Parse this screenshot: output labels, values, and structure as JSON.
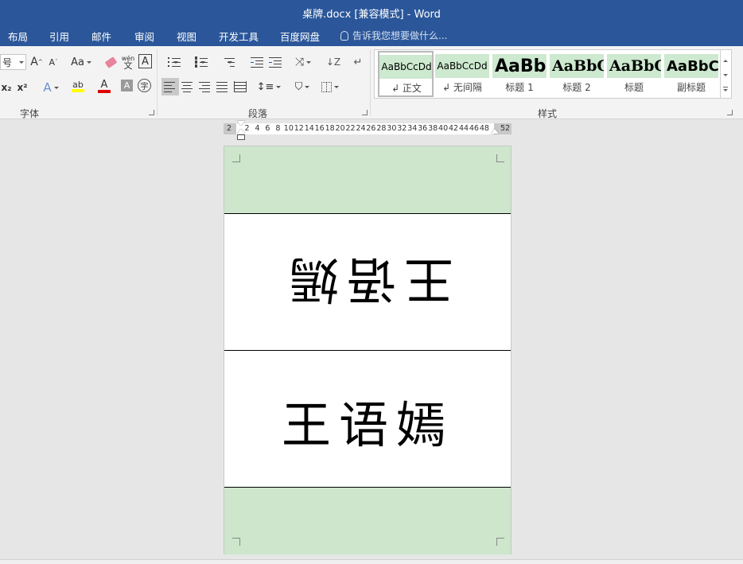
{
  "window": {
    "title": "桌牌.docx [兼容模式] - Word"
  },
  "tabs": [
    "布局",
    "引用",
    "邮件",
    "审阅",
    "视图",
    "开发工具",
    "百度网盘"
  ],
  "tell_me": "告诉我您想要做什么...",
  "font_group": {
    "label": "字体",
    "size_fragment": "号",
    "grow_label": "A",
    "shrink_label": "A",
    "case_label": "Aa",
    "phonetic_label": "wén",
    "phonetic_char": "文",
    "border_char": "A",
    "subscript": "x₂",
    "superscript": "x²",
    "text_effect_label": "A",
    "highlight_label": "ab",
    "font_color_label": "A",
    "char_shading_label": "A",
    "enclose_label": "字",
    "highlight_color": "#ffff00",
    "font_color": "#e00000"
  },
  "paragraph_group": {
    "label": "段落"
  },
  "styles_group": {
    "label": "样式",
    "styles": [
      {
        "sample": "AaBbCcDd",
        "name": "↲ 正文",
        "selected": true
      },
      {
        "sample": "AaBbCcDd",
        "name": "↲ 无间隔",
        "selected": false
      },
      {
        "sample": "AaBb",
        "name": "标题 1",
        "selected": false
      },
      {
        "sample": "AaBbC",
        "name": "标题 2",
        "selected": false
      },
      {
        "sample": "AaBbC",
        "name": "标题",
        "selected": false
      },
      {
        "sample": "AaBbC",
        "name": "副标题",
        "selected": false
      }
    ]
  },
  "ruler": {
    "left_value": "2",
    "right_value": "52",
    "ticks": [
      "2",
      "4",
      "6",
      "8",
      "10",
      "12",
      "14",
      "16",
      "18",
      "20",
      "22",
      "24",
      "26",
      "28",
      "30",
      "32",
      "34",
      "36",
      "38",
      "40",
      "42",
      "44",
      "46",
      "48"
    ]
  },
  "document": {
    "name_upside_down": "王语嫣",
    "name_upright": "王语嫣",
    "shade_color": "#cde6cc"
  }
}
